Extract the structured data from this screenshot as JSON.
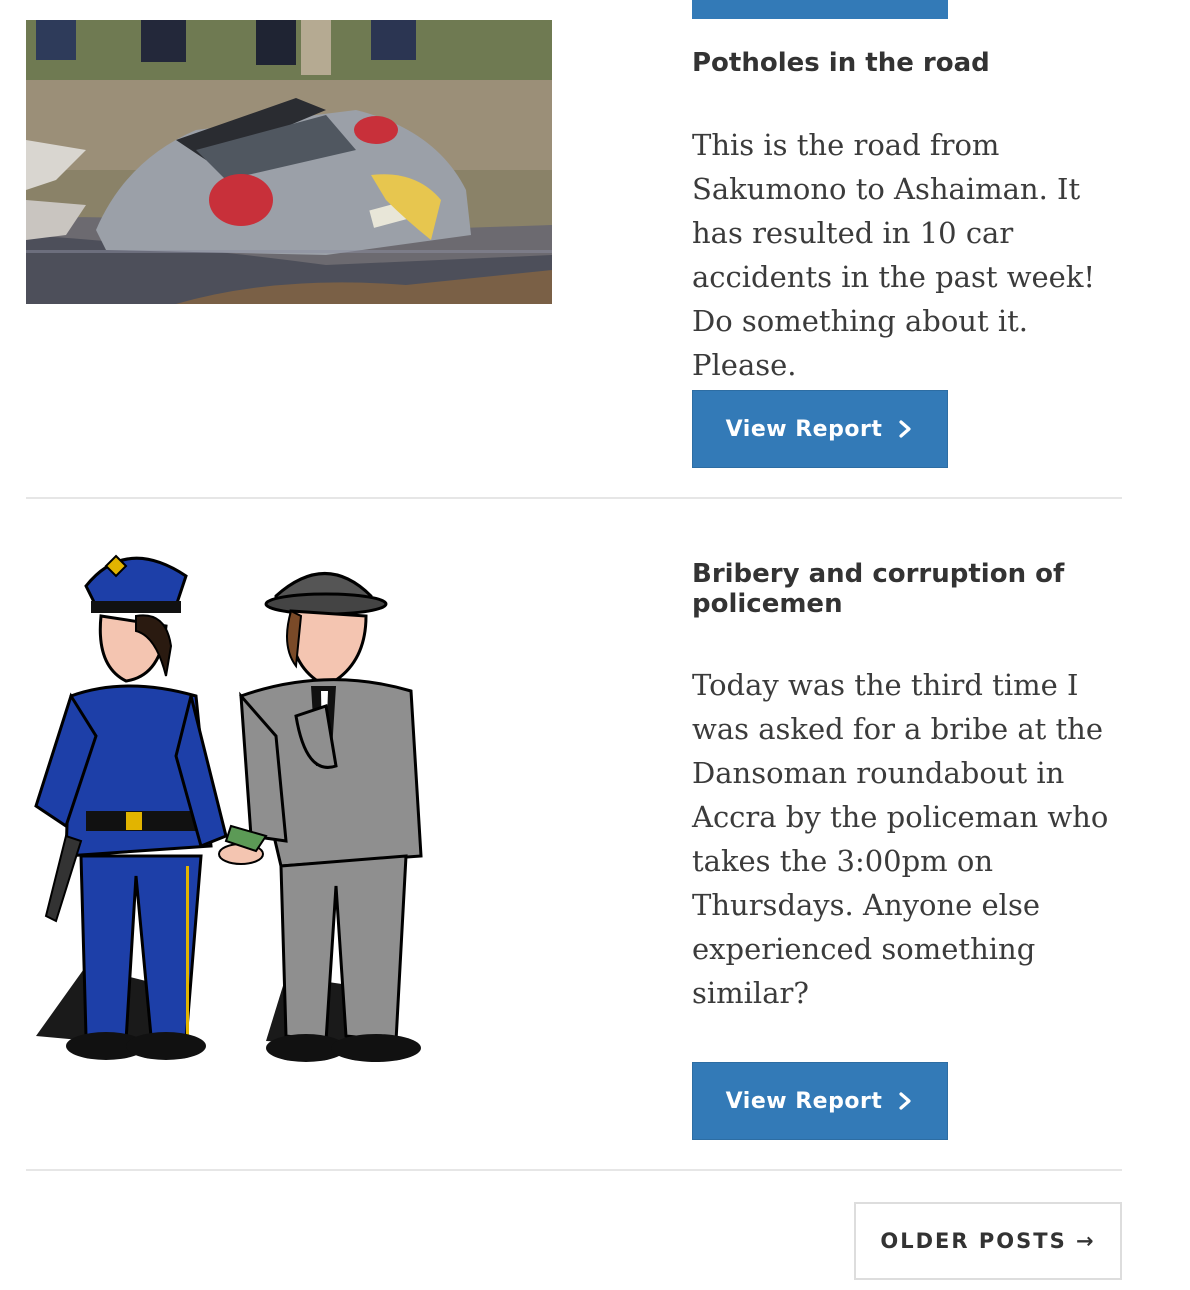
{
  "posts": [
    {
      "title": "Potholes in the road",
      "body": "This is the road from Sakumono to Ashaiman. It has resulted in 10 car accidents in the past week! Do something about it. Please.",
      "button_label": "View Report",
      "image_icon": "sunken-car-photo"
    },
    {
      "title": "Bribery and corruption of policemen",
      "body": "Today was the third time I was asked for a bribe at the Dansoman roundabout in Accra by the policeman who takes the 3:00pm on Thursdays. Anyone else experienced something similar?",
      "button_label": "View Report",
      "image_icon": "police-bribe-cartoon"
    }
  ],
  "pagination": {
    "older_posts_label": "OLDER POSTS →"
  },
  "colors": {
    "button_blue": "#337ab7",
    "text": "#3b3b3b",
    "divider": "#e6e6e6"
  }
}
